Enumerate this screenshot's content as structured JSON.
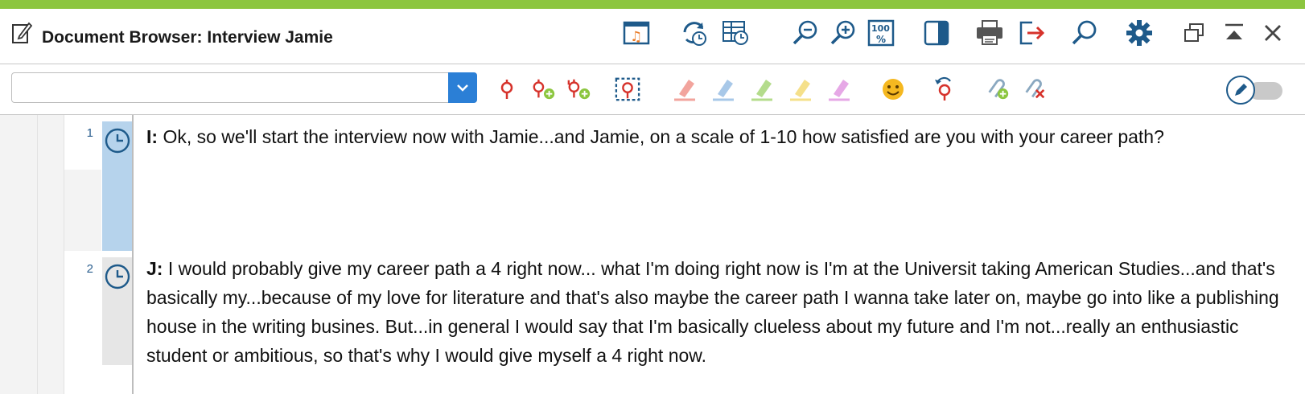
{
  "window": {
    "title": "Document Browser: Interview Jamie",
    "accent_color": "#8cc63f"
  },
  "titlebar_icons": [
    "edit-document-icon",
    "media-player-icon",
    "sync-time-icon",
    "table-time-icon",
    "zoom-out-icon",
    "zoom-in-icon",
    "zoom-100-icon",
    "panel-toggle-icon",
    "print-icon",
    "export-icon",
    "search-icon",
    "settings-gear-icon",
    "restore-window-icon",
    "collapse-up-icon",
    "close-icon"
  ],
  "toolbar": {
    "code_selector": {
      "value": "",
      "placeholder": ""
    },
    "icons": [
      "code-pin-icon",
      "code-pin-add-icon",
      "code-pin-add-multi-icon",
      "code-selection-icon",
      "highlight-red-icon",
      "highlight-blue-icon",
      "highlight-green-icon",
      "highlight-yellow-icon",
      "highlight-magenta-icon",
      "emoticon-icon",
      "undo-code-icon",
      "link-add-icon",
      "link-remove-icon",
      "edit-mode-toggle"
    ],
    "edit_mode_on": false
  },
  "document": {
    "paragraphs": [
      {
        "number": "1",
        "speaker": "I:",
        "text": " Ok, so we'll start the interview now with Jamie...and Jamie, on a scale of 1-10 how satisfied are you with your career path?"
      },
      {
        "number": "2",
        "speaker": "J:",
        "text": " I would probably give my career path a 4 right now... what I'm doing right now is I'm at the Universit taking American Studies...and that's basically my...because of my love for literature and that's also maybe the career path I wanna take later on, maybe go into like a publishing house in the writing busines. But...in general I would say that I'm basically clueless about my future and I'm not...really an enthusiastic student or ambitious, so that's why I would give myself a 4 right now."
      }
    ]
  }
}
